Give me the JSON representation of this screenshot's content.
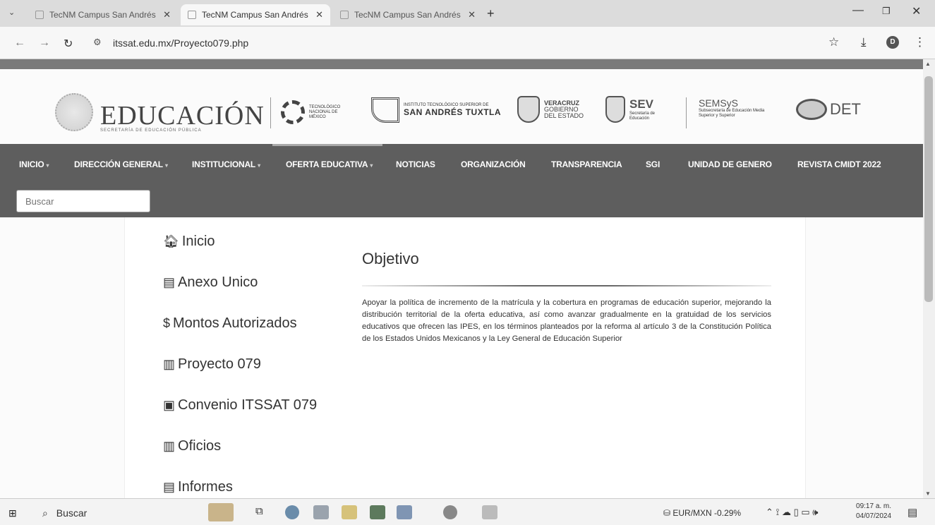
{
  "browser": {
    "tabs": [
      {
        "title": "TecNM Campus San Andrés"
      },
      {
        "title": "TecNM Campus San Andrés"
      },
      {
        "title": "TecNM Campus San Andrés"
      }
    ],
    "url": "itssat.edu.mx/Proyecto079.php",
    "profile_initial": "D"
  },
  "header": {
    "education_title": "EDUCACIÓN",
    "education_sub": "SECRETARÍA DE EDUCACIÓN PÚBLICA",
    "tecnm_text": "TECNOLÓGICO NACIONAL DE MÉXICO",
    "itssat_line1": "INSTITUTO TECNOLÓGICO SUPERIOR DE",
    "itssat_line2": "SAN ANDRÉS TUXTLA",
    "veracruz_lines": [
      "VERACRUZ",
      "GOBIERNO",
      "DEL ESTADO"
    ],
    "sev_big": "SEV",
    "sev_sub": "Secretaría de Educación",
    "semsys_big": "SEMSyS",
    "semsys_sub": "Subsecretaría de Educación Media Superior y Superior",
    "det_big": "DET"
  },
  "nav": {
    "items": [
      {
        "label": "INICIO",
        "dropdown": true
      },
      {
        "label": "DIRECCIÓN GENERAL",
        "dropdown": true
      },
      {
        "label": "INSTITUCIONAL",
        "dropdown": true
      },
      {
        "label": "OFERTA EDUCATIVA",
        "dropdown": true
      },
      {
        "label": "NOTICIAS",
        "dropdown": false
      },
      {
        "label": "ORGANIZACIÓN",
        "dropdown": false
      },
      {
        "label": "TRANSPARENCIA",
        "dropdown": false
      },
      {
        "label": "SGI",
        "dropdown": false
      },
      {
        "label": "UNIDAD DE GENERO",
        "dropdown": false
      },
      {
        "label": "REVISTA CMIDT 2022",
        "dropdown": false
      }
    ],
    "search_placeholder": "Buscar"
  },
  "sidebar": {
    "items": [
      {
        "label": "Inicio",
        "icon": "home-icon"
      },
      {
        "label": "Anexo Unico",
        "icon": "newspaper-icon"
      },
      {
        "label": "Montos Autorizados",
        "icon": "dollar-icon"
      },
      {
        "label": "Proyecto 079",
        "icon": "file-icon"
      },
      {
        "label": "Convenio ITSSAT 079",
        "icon": "signed-doc-icon"
      },
      {
        "label": "Oficios",
        "icon": "file-icon"
      },
      {
        "label": "Informes",
        "icon": "newspaper-icon"
      }
    ]
  },
  "main": {
    "title": "Objetivo",
    "text": "Apoyar la política de incremento de la matrícula y la cobertura en programas de educación superior, mejorando la distribución territorial de la oferta educativa, así como avanzar gradualmente en la gratuidad de los servicios educativos que ofrecen las IPES, en los términos planteados por la reforma al artículo 3 de la Constitución Política de los Estados Unidos Mexicanos y la Ley General de Educación Superior"
  },
  "taskbar": {
    "search_label": "Buscar",
    "currency": "EUR/MXN  -0.29%",
    "time": "09:17 a. m.",
    "date": "04/07/2024"
  }
}
